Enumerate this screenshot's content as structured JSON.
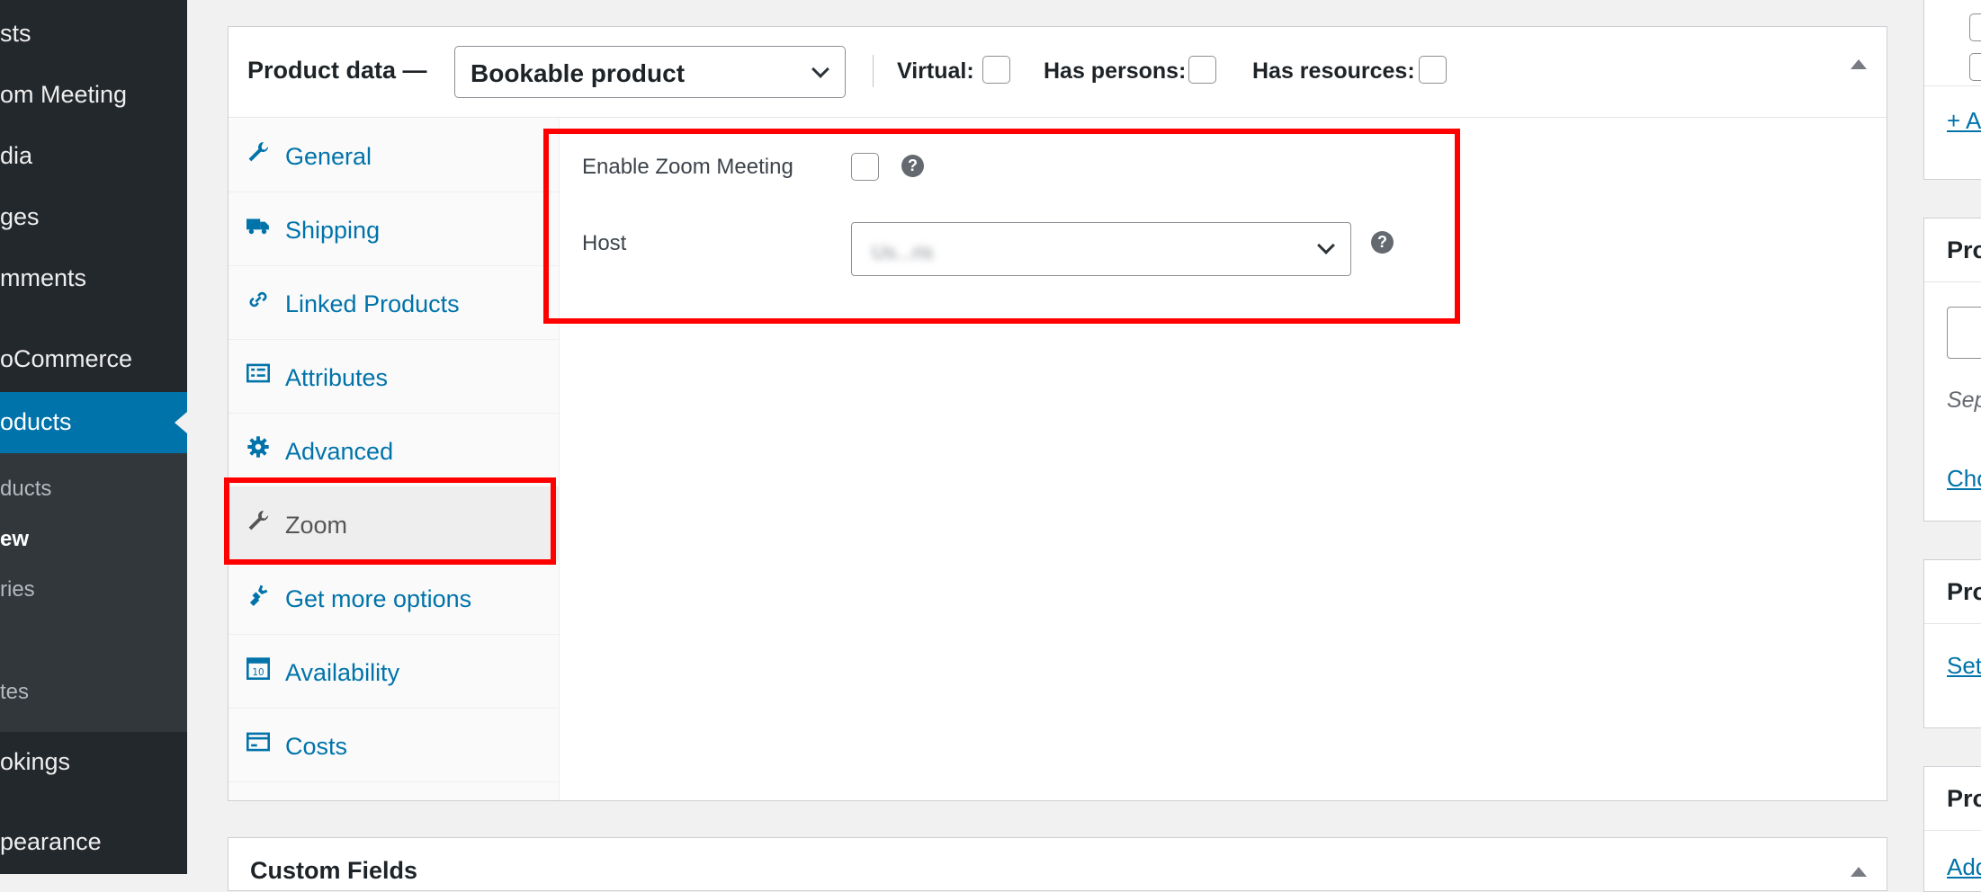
{
  "sidebar": {
    "items": [
      {
        "label": "sts"
      },
      {
        "label": "om Meeting"
      },
      {
        "label": "dia"
      },
      {
        "label": "ges"
      },
      {
        "label": "mments"
      },
      {
        "label": "oCommerce"
      },
      {
        "label": "oducts"
      },
      {
        "label": "okings"
      },
      {
        "label": "pearance"
      }
    ],
    "submenu": [
      {
        "label": "ducts"
      },
      {
        "label": "ew"
      },
      {
        "label": "ries"
      },
      {
        "label": "tes"
      }
    ]
  },
  "product_data": {
    "title": "Product data —",
    "type_value": "Bookable product",
    "virtual_label": "Virtual:",
    "has_persons_label": "Has persons:",
    "has_resources_label": "Has resources:",
    "tabs": [
      {
        "label": "General",
        "icon": "wrench-icon"
      },
      {
        "label": "Shipping",
        "icon": "truck-icon"
      },
      {
        "label": "Linked Products",
        "icon": "link-icon"
      },
      {
        "label": "Attributes",
        "icon": "list-icon"
      },
      {
        "label": "Advanced",
        "icon": "gear-icon"
      },
      {
        "label": "Zoom",
        "icon": "wrench-icon"
      },
      {
        "label": "Get more options",
        "icon": "plugin-icon"
      },
      {
        "label": "Availability",
        "icon": "calendar-icon"
      },
      {
        "label": "Costs",
        "icon": "card-icon"
      }
    ],
    "active_tab": "Zoom",
    "zoom_panel": {
      "enable_label": "Enable Zoom Meeting",
      "host_label": "Host",
      "host_value": "Us...ris",
      "help_symbol": "?"
    }
  },
  "custom_fields": {
    "title": "Custom Fields"
  },
  "right_column": {
    "top_link": "+ A",
    "box1_title": "Pro",
    "box1_note": "Sep",
    "box1_link": "Cho",
    "box2_title": "Pro",
    "box2_link": "Set",
    "box3_title": "Pro",
    "box3_link": "Add"
  },
  "colors": {
    "sidebar_bg": "#23282d",
    "active_menu": "#0073aa",
    "link": "#0073aa",
    "highlight": "#ff0000"
  }
}
